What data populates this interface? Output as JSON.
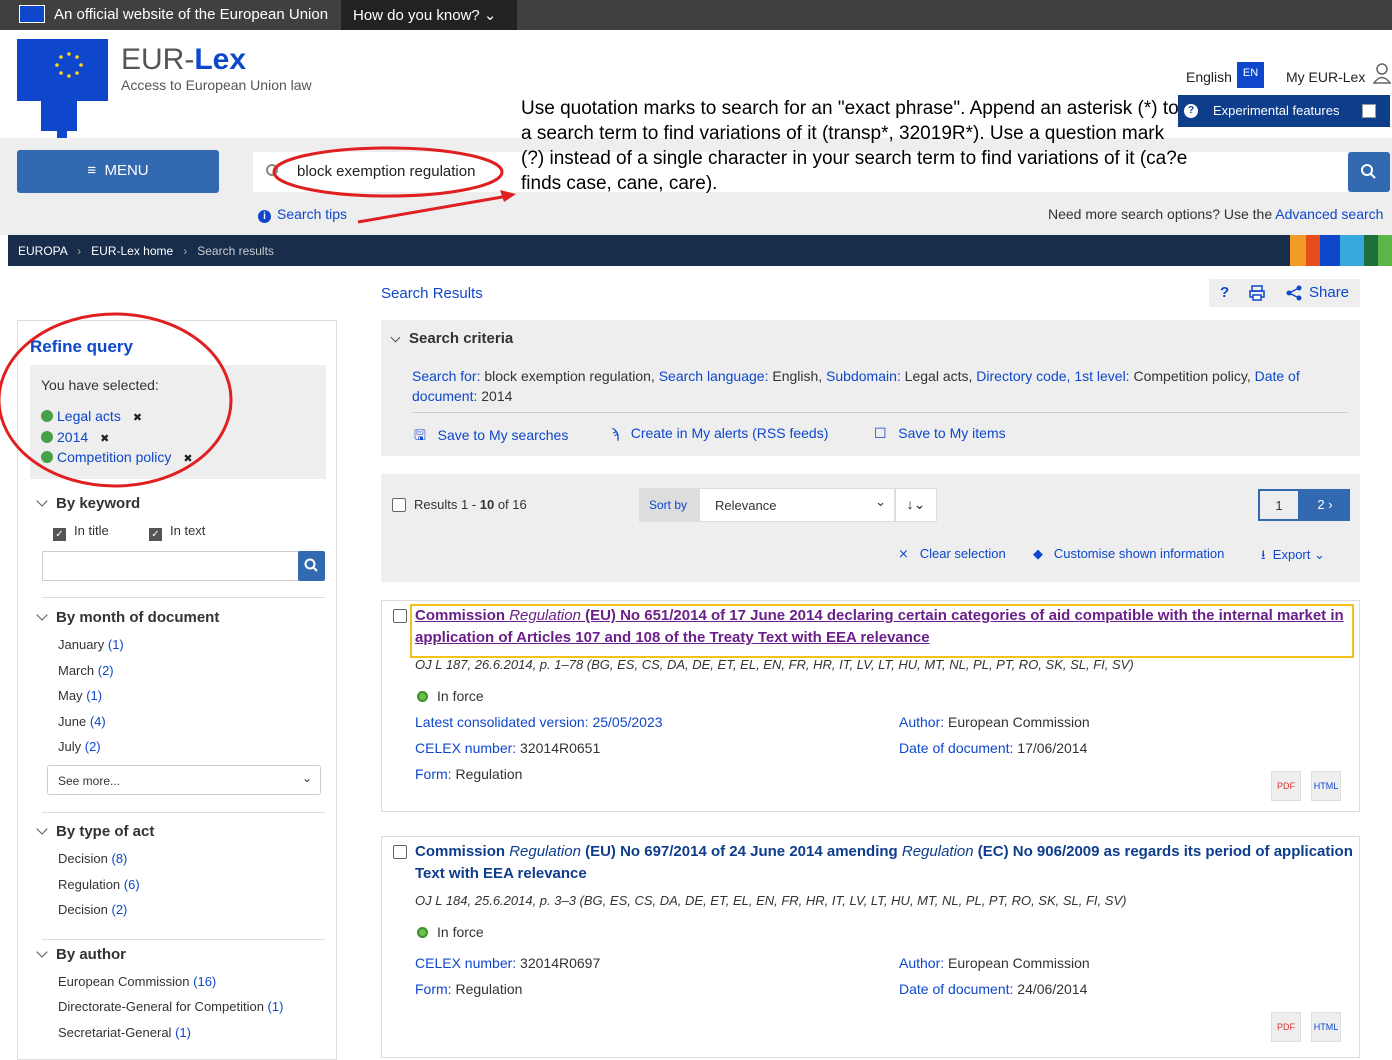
{
  "topbar": {
    "official": "An official website of the European Union",
    "how": "How do you know?"
  },
  "brand": {
    "eur": "EUR-",
    "lex": "Lex",
    "subtitle": "Access to European Union law"
  },
  "header": {
    "lang": "English",
    "lang_code": "EN",
    "my_eurlex": "My EUR-Lex",
    "experimental": "Experimental features"
  },
  "tip": "Use quotation marks to search for an \"exact phrase\". Append an asterisk (*) to a search term to find variations of it (transp*, 32019R*). Use a question mark (?) instead of a single character in your search term to find variations of it (ca?e finds case, cane, care).",
  "search": {
    "menu": "MENU",
    "value": "block exemption regulation",
    "tips": "Search tips",
    "more_prefix": "Need more search options? Use the ",
    "advanced": "Advanced search"
  },
  "breadcrumb": {
    "europa": "EUROPA",
    "home": "EUR-Lex home",
    "current": "Search results"
  },
  "results_title": "Search Results",
  "tools": {
    "help": "?",
    "share": "Share"
  },
  "refine": {
    "title": "Refine query",
    "selected_label": "You have selected:",
    "selected": [
      "Legal acts",
      "2014",
      "Competition policy"
    ],
    "keyword": {
      "title": "By keyword",
      "in_title": "In title",
      "in_text": "In text"
    },
    "month": {
      "title": "By month of document",
      "items": [
        {
          "label": "January",
          "count": "(1)"
        },
        {
          "label": "March",
          "count": "(2)"
        },
        {
          "label": "May",
          "count": "(1)"
        },
        {
          "label": "June",
          "count": "(4)"
        },
        {
          "label": "July",
          "count": "(2)"
        }
      ],
      "see_more": "See more..."
    },
    "type": {
      "title": "By type of act",
      "items": [
        {
          "label": "Decision",
          "count": "(8)"
        },
        {
          "label": "Regulation",
          "count": "(6)"
        },
        {
          "label": "Decision",
          "count": "(2)"
        }
      ]
    },
    "author": {
      "title": "By author",
      "items": [
        {
          "label": "European Commission",
          "count": "(16)"
        },
        {
          "label": "Directorate-General for Competition",
          "count": "(1)"
        },
        {
          "label": "Secretariat-General",
          "count": "(1)"
        }
      ]
    }
  },
  "criteria": {
    "title": "Search criteria",
    "search_for_label": "Search for:",
    "search_for": " block exemption regulation, ",
    "lang_label": "Search language:",
    "lang": " English, ",
    "subdomain_label": "Subdomain:",
    "subdomain": " Legal acts, ",
    "dir_label": "Directory code, 1st level:",
    "dir": " Competition policy, ",
    "date_label": "Date of document:",
    "date": " 2014",
    "save_searches": "Save to My searches",
    "alerts": "Create in My alerts (RSS feeds)",
    "save_items": "Save to My items"
  },
  "resbar": {
    "results_prefix": "Results 1 - ",
    "results_to": "10",
    "results_of": " of 16",
    "sort_label": "Sort by",
    "sort_value": "Relevance",
    "page1": "1",
    "page2": "2 ›",
    "clear": "Clear selection",
    "customise": "Customise shown information",
    "export": "Export"
  },
  "results": [
    {
      "t1": "Commission ",
      "t2": "Regulation ",
      "t3": "(EU) No 651/2014 of 17 June 2014 declaring certain categories of aid compatible with the internal market in application of Articles 107 and 108 of the Treaty Text with EEA relevance",
      "oj": "OJ L 187, 26.6.2014, p. 1–78 (BG, ES, CS, DA, DE, ET, EL, EN, FR, HR, IT, LV, LT, HU, MT, NL, PL, PT, RO, SK, SL, FI, SV)",
      "status": "In force",
      "consol_label": "Latest consolidated version:",
      "consol": "25/05/2023",
      "celex_label": "CELEX number:",
      "celex": " 32014R0651",
      "form_label": "Form:",
      "form": " Regulation",
      "author_label": "Author:",
      "author": " European Commission",
      "date_label": "Date of document:",
      "date": " 17/06/2014"
    },
    {
      "t1": "Commission ",
      "t2": "Regulation ",
      "t3": "(EU) No 697/2014 of 24 June 2014 amending ",
      "t4": "Regulation ",
      "t5": "(EC) No 906/2009 as regards its period of application Text with EEA relevance",
      "oj": "OJ L 184, 25.6.2014, p. 3–3 (BG, ES, CS, DA, DE, ET, EL, EN, FR, HR, IT, LV, LT, HU, MT, NL, PL, PT, RO, SK, SL, FI, SV)",
      "status": "In force",
      "celex_label": "CELEX number:",
      "celex": " 32014R0697",
      "form_label": "Form:",
      "form": " Regulation",
      "author_label": "Author:",
      "author": " European Commission",
      "date_label": "Date of document:",
      "date": " 24/06/2014"
    }
  ],
  "colors": {
    "eu_blue": "#0e47cb",
    "button_blue": "#3369b1",
    "annotation_red": "#e02020",
    "highlight": "#f3c21b"
  }
}
